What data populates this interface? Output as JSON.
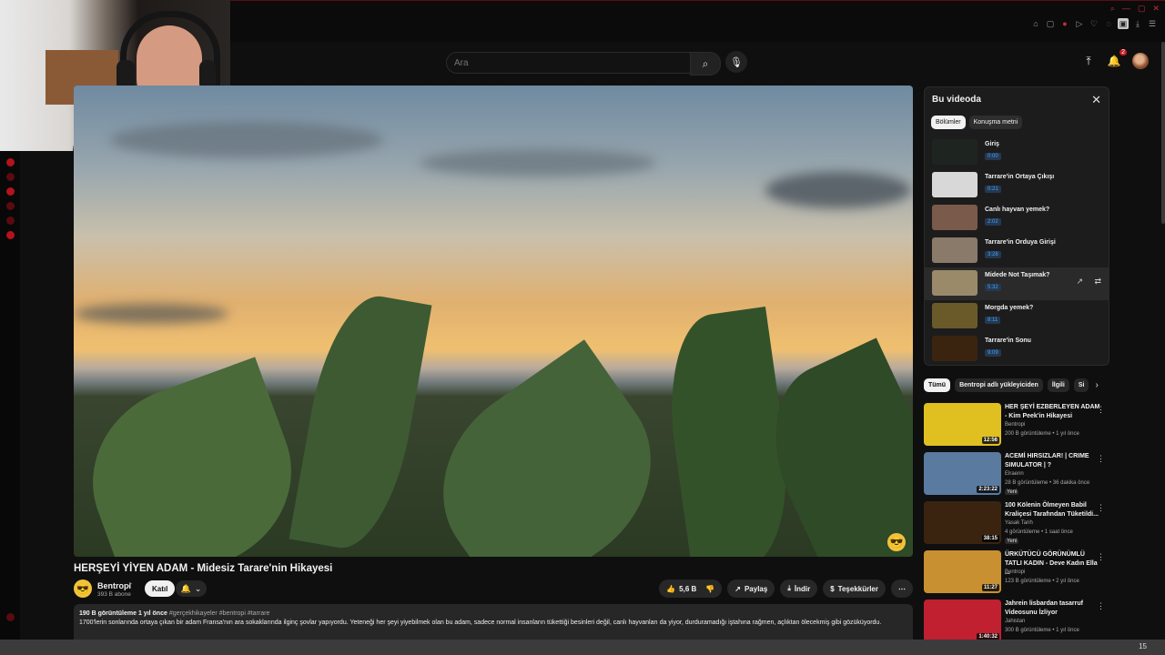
{
  "search": {
    "placeholder": "Ara"
  },
  "notifications": {
    "count": "2"
  },
  "video": {
    "title": "HERŞEYİ YİYEN ADAM - Midesiz Tarare'nin Hikayesi",
    "channel": "Bentropi",
    "subscribers": "393 B abone",
    "join_label": "Katıl",
    "likes": "5,6 B",
    "share_label": "Paylaş",
    "download_label": "İndir",
    "thanks_label": "Teşekkürler",
    "views_age": "190 B görüntüleme  1 yıl önce",
    "hashtags": "#gerçekhikayeler #bentropi #tarrare",
    "description": "1700'lerin sonlarında ortaya çıkan bir adam Fransa'nın ara sokaklarında ilginç şovlar yapıyordu. Yeteneği her şeyi yiyebilmek olan bu adam, sadece normal insanların tükettiği besinleri değil, canlı hayvanları da yiyor, durduramadığı iştahına rağmen, açlıktan ölecekmiş gibi gözüküyordu."
  },
  "chapters": {
    "title": "Bu videoda",
    "tabs": [
      "Bölümler",
      "Konuşma metni"
    ],
    "items": [
      {
        "title": "Giriş",
        "time": "0:00",
        "thumb": "#1e2420"
      },
      {
        "title": "Tarrare'in Ortaya Çıkışı",
        "time": "0:21",
        "thumb": "#d8d8d8"
      },
      {
        "title": "Canlı hayvan yemek?",
        "time": "2:02",
        "thumb": "#7a5a4a"
      },
      {
        "title": "Tarrare'in Orduya Girişi",
        "time": "3:28",
        "thumb": "#8a7a6a"
      },
      {
        "title": "Midede Not Taşımak?",
        "time": "5:32",
        "thumb": "#9a8a6a"
      },
      {
        "title": "Morgda yemek?",
        "time": "8:11",
        "thumb": "#6a5a2a"
      },
      {
        "title": "Tarrare'in Sonu",
        "time": "9:09",
        "thumb": "#3a2410"
      }
    ]
  },
  "related_chips": [
    "Tümü",
    "Bentropi adlı yükleyiciden",
    "İlgili",
    "Si"
  ],
  "related": [
    {
      "title": "HER ŞEYİ EZBERLEYEN ADAM - Kim Peek'in Hikayesi",
      "channel": "Bentropi",
      "meta": "200 B görüntüleme • 1 yıl önce",
      "duration": "12:56",
      "thumb": "#e0c020",
      "badge": ""
    },
    {
      "title": "ACEMİ HIRSIZLAR! | CRIME SIMULATOR | ?",
      "channel": "Elraenn",
      "meta": "28 B görüntüleme • 36 dakika önce",
      "duration": "2:23:22",
      "thumb": "#5a7aa0",
      "badge": "Yeni"
    },
    {
      "title": "100 Kölenin Ölmeyen Babil Kraliçesi Tarafından Tüketildi...",
      "channel": "Yasak Tarih",
      "meta": "4 görüntüleme • 1 saat önce",
      "duration": "38:15",
      "thumb": "#3a2410",
      "badge": "Yeni"
    },
    {
      "title": "ÜRKÜTÜCÜ GÖRÜNÜMLÜ TATLI KADIN - Deve Kadın Ella ...",
      "channel": "Bentropi",
      "meta": "123 B görüntüleme • 2 yıl önce",
      "duration": "11:27",
      "thumb": "#c89030",
      "badge": ""
    },
    {
      "title": "Jahrein lisbardan tasarruf Videosunu İzliyor",
      "channel": "Jahistan",
      "meta": "300 B görüntüleme • 1 yıl önce",
      "duration": "1:40:32",
      "thumb": "#c02030",
      "badge": ""
    }
  ],
  "clock": {
    "time": "15"
  }
}
